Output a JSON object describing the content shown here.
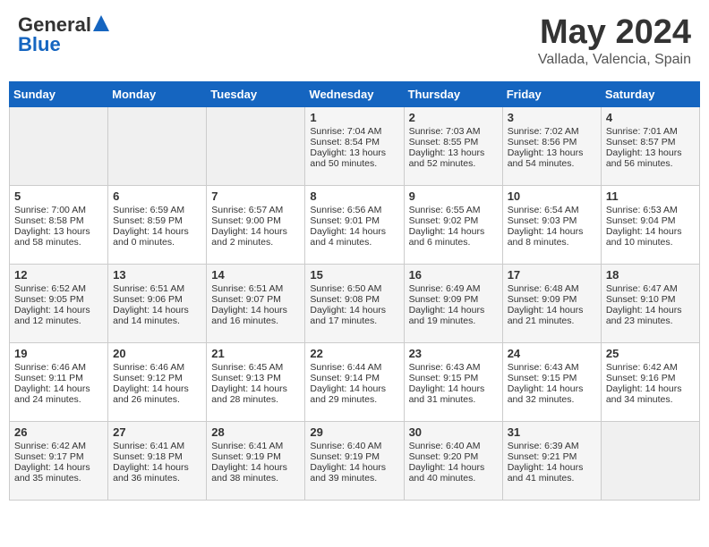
{
  "header": {
    "logo_general": "General",
    "logo_blue": "Blue",
    "title": "May 2024",
    "location": "Vallada, Valencia, Spain"
  },
  "weekdays": [
    "Sunday",
    "Monday",
    "Tuesday",
    "Wednesday",
    "Thursday",
    "Friday",
    "Saturday"
  ],
  "weeks": [
    [
      {
        "day": "",
        "empty": true
      },
      {
        "day": "",
        "empty": true
      },
      {
        "day": "",
        "empty": true
      },
      {
        "day": "1",
        "sunrise": "Sunrise: 7:04 AM",
        "sunset": "Sunset: 8:54 PM",
        "daylight": "Daylight: 13 hours and 50 minutes."
      },
      {
        "day": "2",
        "sunrise": "Sunrise: 7:03 AM",
        "sunset": "Sunset: 8:55 PM",
        "daylight": "Daylight: 13 hours and 52 minutes."
      },
      {
        "day": "3",
        "sunrise": "Sunrise: 7:02 AM",
        "sunset": "Sunset: 8:56 PM",
        "daylight": "Daylight: 13 hours and 54 minutes."
      },
      {
        "day": "4",
        "sunrise": "Sunrise: 7:01 AM",
        "sunset": "Sunset: 8:57 PM",
        "daylight": "Daylight: 13 hours and 56 minutes."
      }
    ],
    [
      {
        "day": "5",
        "sunrise": "Sunrise: 7:00 AM",
        "sunset": "Sunset: 8:58 PM",
        "daylight": "Daylight: 13 hours and 58 minutes."
      },
      {
        "day": "6",
        "sunrise": "Sunrise: 6:59 AM",
        "sunset": "Sunset: 8:59 PM",
        "daylight": "Daylight: 14 hours and 0 minutes."
      },
      {
        "day": "7",
        "sunrise": "Sunrise: 6:57 AM",
        "sunset": "Sunset: 9:00 PM",
        "daylight": "Daylight: 14 hours and 2 minutes."
      },
      {
        "day": "8",
        "sunrise": "Sunrise: 6:56 AM",
        "sunset": "Sunset: 9:01 PM",
        "daylight": "Daylight: 14 hours and 4 minutes."
      },
      {
        "day": "9",
        "sunrise": "Sunrise: 6:55 AM",
        "sunset": "Sunset: 9:02 PM",
        "daylight": "Daylight: 14 hours and 6 minutes."
      },
      {
        "day": "10",
        "sunrise": "Sunrise: 6:54 AM",
        "sunset": "Sunset: 9:03 PM",
        "daylight": "Daylight: 14 hours and 8 minutes."
      },
      {
        "day": "11",
        "sunrise": "Sunrise: 6:53 AM",
        "sunset": "Sunset: 9:04 PM",
        "daylight": "Daylight: 14 hours and 10 minutes."
      }
    ],
    [
      {
        "day": "12",
        "sunrise": "Sunrise: 6:52 AM",
        "sunset": "Sunset: 9:05 PM",
        "daylight": "Daylight: 14 hours and 12 minutes."
      },
      {
        "day": "13",
        "sunrise": "Sunrise: 6:51 AM",
        "sunset": "Sunset: 9:06 PM",
        "daylight": "Daylight: 14 hours and 14 minutes."
      },
      {
        "day": "14",
        "sunrise": "Sunrise: 6:51 AM",
        "sunset": "Sunset: 9:07 PM",
        "daylight": "Daylight: 14 hours and 16 minutes."
      },
      {
        "day": "15",
        "sunrise": "Sunrise: 6:50 AM",
        "sunset": "Sunset: 9:08 PM",
        "daylight": "Daylight: 14 hours and 17 minutes."
      },
      {
        "day": "16",
        "sunrise": "Sunrise: 6:49 AM",
        "sunset": "Sunset: 9:09 PM",
        "daylight": "Daylight: 14 hours and 19 minutes."
      },
      {
        "day": "17",
        "sunrise": "Sunrise: 6:48 AM",
        "sunset": "Sunset: 9:09 PM",
        "daylight": "Daylight: 14 hours and 21 minutes."
      },
      {
        "day": "18",
        "sunrise": "Sunrise: 6:47 AM",
        "sunset": "Sunset: 9:10 PM",
        "daylight": "Daylight: 14 hours and 23 minutes."
      }
    ],
    [
      {
        "day": "19",
        "sunrise": "Sunrise: 6:46 AM",
        "sunset": "Sunset: 9:11 PM",
        "daylight": "Daylight: 14 hours and 24 minutes."
      },
      {
        "day": "20",
        "sunrise": "Sunrise: 6:46 AM",
        "sunset": "Sunset: 9:12 PM",
        "daylight": "Daylight: 14 hours and 26 minutes."
      },
      {
        "day": "21",
        "sunrise": "Sunrise: 6:45 AM",
        "sunset": "Sunset: 9:13 PM",
        "daylight": "Daylight: 14 hours and 28 minutes."
      },
      {
        "day": "22",
        "sunrise": "Sunrise: 6:44 AM",
        "sunset": "Sunset: 9:14 PM",
        "daylight": "Daylight: 14 hours and 29 minutes."
      },
      {
        "day": "23",
        "sunrise": "Sunrise: 6:43 AM",
        "sunset": "Sunset: 9:15 PM",
        "daylight": "Daylight: 14 hours and 31 minutes."
      },
      {
        "day": "24",
        "sunrise": "Sunrise: 6:43 AM",
        "sunset": "Sunset: 9:15 PM",
        "daylight": "Daylight: 14 hours and 32 minutes."
      },
      {
        "day": "25",
        "sunrise": "Sunrise: 6:42 AM",
        "sunset": "Sunset: 9:16 PM",
        "daylight": "Daylight: 14 hours and 34 minutes."
      }
    ],
    [
      {
        "day": "26",
        "sunrise": "Sunrise: 6:42 AM",
        "sunset": "Sunset: 9:17 PM",
        "daylight": "Daylight: 14 hours and 35 minutes."
      },
      {
        "day": "27",
        "sunrise": "Sunrise: 6:41 AM",
        "sunset": "Sunset: 9:18 PM",
        "daylight": "Daylight: 14 hours and 36 minutes."
      },
      {
        "day": "28",
        "sunrise": "Sunrise: 6:41 AM",
        "sunset": "Sunset: 9:19 PM",
        "daylight": "Daylight: 14 hours and 38 minutes."
      },
      {
        "day": "29",
        "sunrise": "Sunrise: 6:40 AM",
        "sunset": "Sunset: 9:19 PM",
        "daylight": "Daylight: 14 hours and 39 minutes."
      },
      {
        "day": "30",
        "sunrise": "Sunrise: 6:40 AM",
        "sunset": "Sunset: 9:20 PM",
        "daylight": "Daylight: 14 hours and 40 minutes."
      },
      {
        "day": "31",
        "sunrise": "Sunrise: 6:39 AM",
        "sunset": "Sunset: 9:21 PM",
        "daylight": "Daylight: 14 hours and 41 minutes."
      },
      {
        "day": "",
        "empty": true
      }
    ]
  ]
}
